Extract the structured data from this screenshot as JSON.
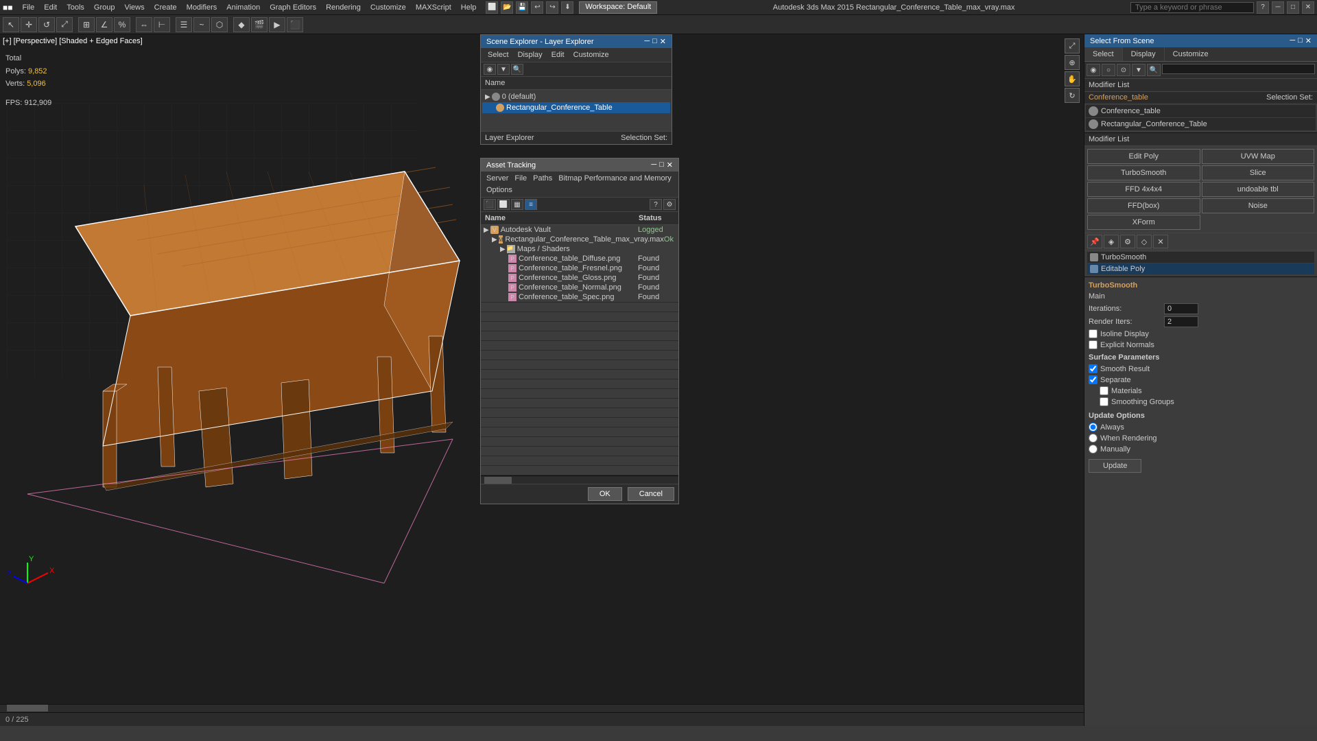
{
  "topbar": {
    "logo": "■",
    "menu_items": [
      "File",
      "Edit",
      "Tools",
      "Group",
      "Views",
      "Create",
      "Modifiers",
      "Animation",
      "Graph Editors",
      "Rendering",
      "Customize",
      "MAXScript",
      "Help"
    ],
    "workspace_label": "Workspace: Default",
    "title": "Autodesk 3ds Max 2015    Rectangular_Conference_Table_max_vray.max",
    "search_placeholder": "Type a keyword or phrase"
  },
  "viewport": {
    "label": "[+] [Perspective] [Shaded + Edged Faces]",
    "stats": {
      "polys_label": "Polys:",
      "polys_value": "9,852",
      "verts_label": "Verts:",
      "verts_value": "5,096",
      "fps_label": "FPS:",
      "fps_value": "912,909"
    }
  },
  "scene_explorer": {
    "title": "Scene Explorer - Layer Explorer",
    "menu": [
      "Select",
      "Display",
      "Edit",
      "Customize"
    ],
    "col_header": "Name",
    "items": [
      {
        "name": "0 (default)",
        "level": 0,
        "type": "layer"
      },
      {
        "name": "Rectangular_Conference_Table",
        "level": 1,
        "type": "object",
        "selected": true
      }
    ],
    "footer_left": "Layer Explorer",
    "footer_right": "Selection Set:"
  },
  "asset_tracking": {
    "title": "Asset Tracking",
    "menu": [
      "Server",
      "File",
      "Paths",
      "Bitmap Performance and Memory",
      "Options"
    ],
    "columns": {
      "name": "Name",
      "status": "Status"
    },
    "rows": [
      {
        "name": "Autodesk Vault",
        "level": 0,
        "status": "Logged",
        "type": "vault"
      },
      {
        "name": "Rectangular_Conference_Table_max_vray.max",
        "level": 1,
        "status": "Ok",
        "type": "max"
      },
      {
        "name": "Maps / Shaders",
        "level": 2,
        "status": "",
        "type": "folder"
      },
      {
        "name": "Conference_table_Diffuse.png",
        "level": 3,
        "status": "Found",
        "type": "png"
      },
      {
        "name": "Conference_table_Fresnel.png",
        "level": 3,
        "status": "Found",
        "type": "png"
      },
      {
        "name": "Conference_table_Gloss.png",
        "level": 3,
        "status": "Found",
        "type": "png"
      },
      {
        "name": "Conference_table_Normal.png",
        "level": 3,
        "status": "Found",
        "type": "png"
      },
      {
        "name": "Conference_table_Spec.png",
        "level": 3,
        "status": "Found",
        "type": "png"
      }
    ],
    "footer_buttons": [
      "OK",
      "Cancel"
    ]
  },
  "select_from_scene": {
    "title": "Select From Scene",
    "close_btn": "✕",
    "tabs": [
      "Select",
      "Display",
      "Customize"
    ],
    "modifier_label": "Modifier List",
    "object_name": "Conference_table",
    "selection_set_label": "Selection Set:",
    "modifier_buttons": [
      {
        "label": "Edit Poly"
      },
      {
        "label": "UVW Map"
      },
      {
        "label": "TurboSmooth"
      },
      {
        "label": "Slice"
      },
      {
        "label": "FFD 4x4x4"
      },
      {
        "label": "undoable tbl"
      },
      {
        "label": "FFD(box)"
      },
      {
        "label": "Noise"
      },
      {
        "label": "XForm"
      }
    ],
    "stack_items": [
      {
        "name": "TurboSmooth",
        "active": false
      },
      {
        "name": "Editable Poly",
        "active": true
      }
    ],
    "scene_items": [
      {
        "name": "Conference_table",
        "selected": false
      },
      {
        "name": "Rectangular_Conference_Table",
        "selected": false
      }
    ]
  },
  "turbosmooth": {
    "title": "TurboSmooth",
    "main_section": "Main",
    "iterations_label": "Iterations:",
    "iterations_value": "0",
    "render_iters_label": "Render Iters:",
    "render_iters_value": "2",
    "isoline_display_label": "Isoline Display",
    "isoline_checked": false,
    "explicit_normals_label": "Explicit Normals",
    "explicit_checked": false,
    "surface_params_label": "Surface Parameters",
    "smooth_result_label": "Smooth Result",
    "smooth_checked": true,
    "separate_label": "Separate",
    "separate_checked": true,
    "materials_label": "Materials",
    "materials_checked": false,
    "smoothing_groups_label": "Smoothing Groups",
    "smoothing_checked": false,
    "update_options_label": "Update Options",
    "always_label": "Always",
    "when_rendering_label": "When Rendering",
    "manually_label": "Manually",
    "update_btn": "Update"
  },
  "status_bar": {
    "left": "0 / 225",
    "scroll_indicator": ""
  },
  "icons": {
    "close": "✕",
    "minimize": "─",
    "maximize": "□",
    "arrow_right": "▶",
    "arrow_down": "▼",
    "check": "✓",
    "folder": "📁",
    "lock": "🔒"
  }
}
